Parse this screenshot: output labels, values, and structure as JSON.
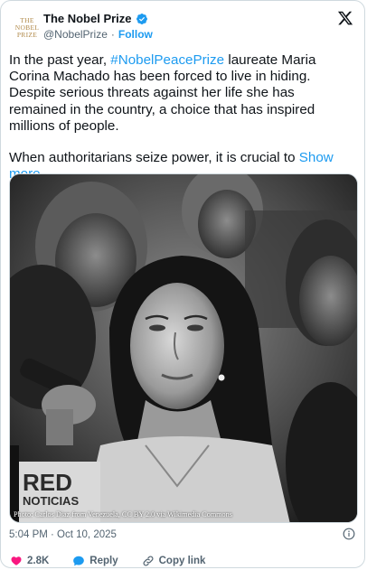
{
  "account": {
    "avatar_lines": [
      "THE",
      "NOBEL",
      "PRIZE"
    ],
    "name": "The Nobel Prize",
    "handle": "@NobelPrize",
    "separator": "·",
    "follow_label": "Follow"
  },
  "tweet": {
    "hashtag": "#NobelPeacePrize",
    "text_before_hashtag": "In the past year, ",
    "text_after_hashtag": " laureate Maria Corina Machado has been forced to live in hiding. Despite serious threats against her life she has remained in the country, a choice that has inspired millions of people.",
    "second_paragraph": "When authoritarians seize power, it is crucial to ",
    "show_more_label": "Show more"
  },
  "media": {
    "caption": "Photo: Carlos Diaz from Venezuela, CC BY 2.0 via Wikimedia Commons",
    "sign_text_1": "RED",
    "sign_text_2": "NOTICIAS"
  },
  "meta": {
    "timestamp": "5:04 PM · Oct 10, 2025"
  },
  "actions": {
    "likes": "2.8K",
    "reply_label": "Reply",
    "copy_link_label": "Copy link"
  },
  "colors": {
    "accent": "#1d9bf0",
    "like": "#f91880",
    "muted": "#536471"
  },
  "icons": [
    "verified-badge-icon",
    "x-logo-icon",
    "info-icon",
    "heart-icon",
    "reply-icon",
    "link-icon"
  ]
}
